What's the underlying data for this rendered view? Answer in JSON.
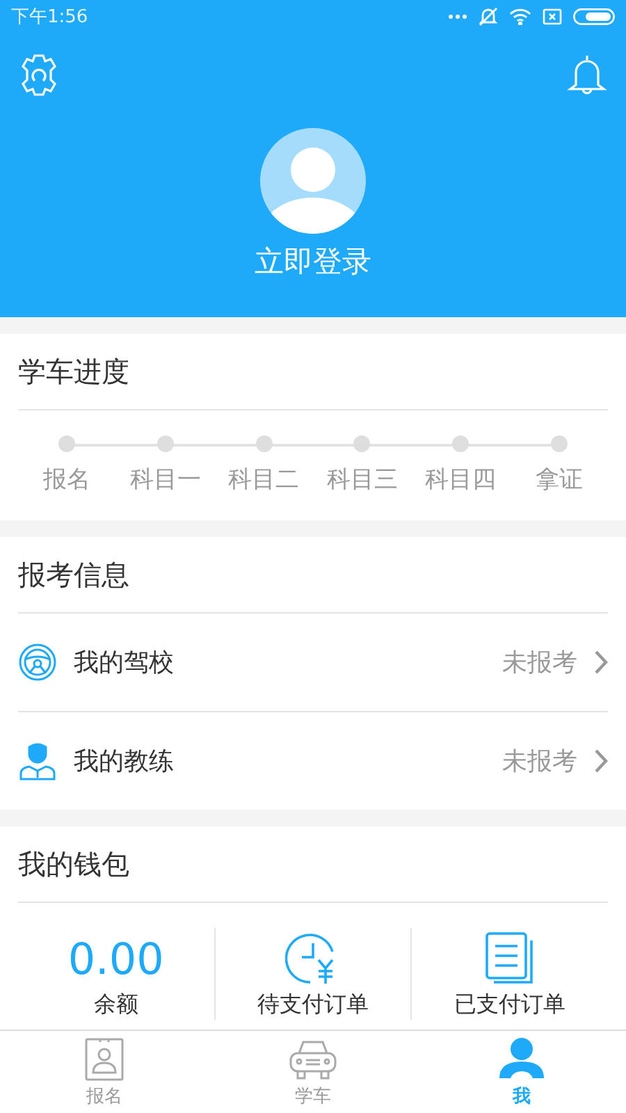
{
  "status_bar": {
    "time": "下午1:56"
  },
  "header": {
    "login": "立即登录"
  },
  "progress": {
    "title": "学车进度",
    "steps": [
      {
        "label": "报名",
        "done": false
      },
      {
        "label": "科目一",
        "done": false
      },
      {
        "label": "科目二",
        "done": false
      },
      {
        "label": "科目三",
        "done": false
      },
      {
        "label": "科目四",
        "done": false
      },
      {
        "label": "拿证",
        "done": false
      }
    ]
  },
  "registration": {
    "title": "报考信息",
    "items": [
      {
        "kind": "school",
        "label": "我的驾校",
        "status": "未报考"
      },
      {
        "kind": "coach",
        "label": "我的教练",
        "status": "未报考"
      }
    ]
  },
  "wallet": {
    "title": "我的钱包",
    "balance": "0.00",
    "balance_label": "余额",
    "items": [
      {
        "kind": "pending",
        "label": "待支付订单"
      },
      {
        "kind": "paid",
        "label": "已支付订单"
      }
    ]
  },
  "tab_bar": [
    {
      "kind": "signup",
      "label": "报名",
      "selected": false
    },
    {
      "kind": "car",
      "label": "学车",
      "selected": false
    },
    {
      "kind": "me",
      "label": "我",
      "selected": true
    }
  ]
}
